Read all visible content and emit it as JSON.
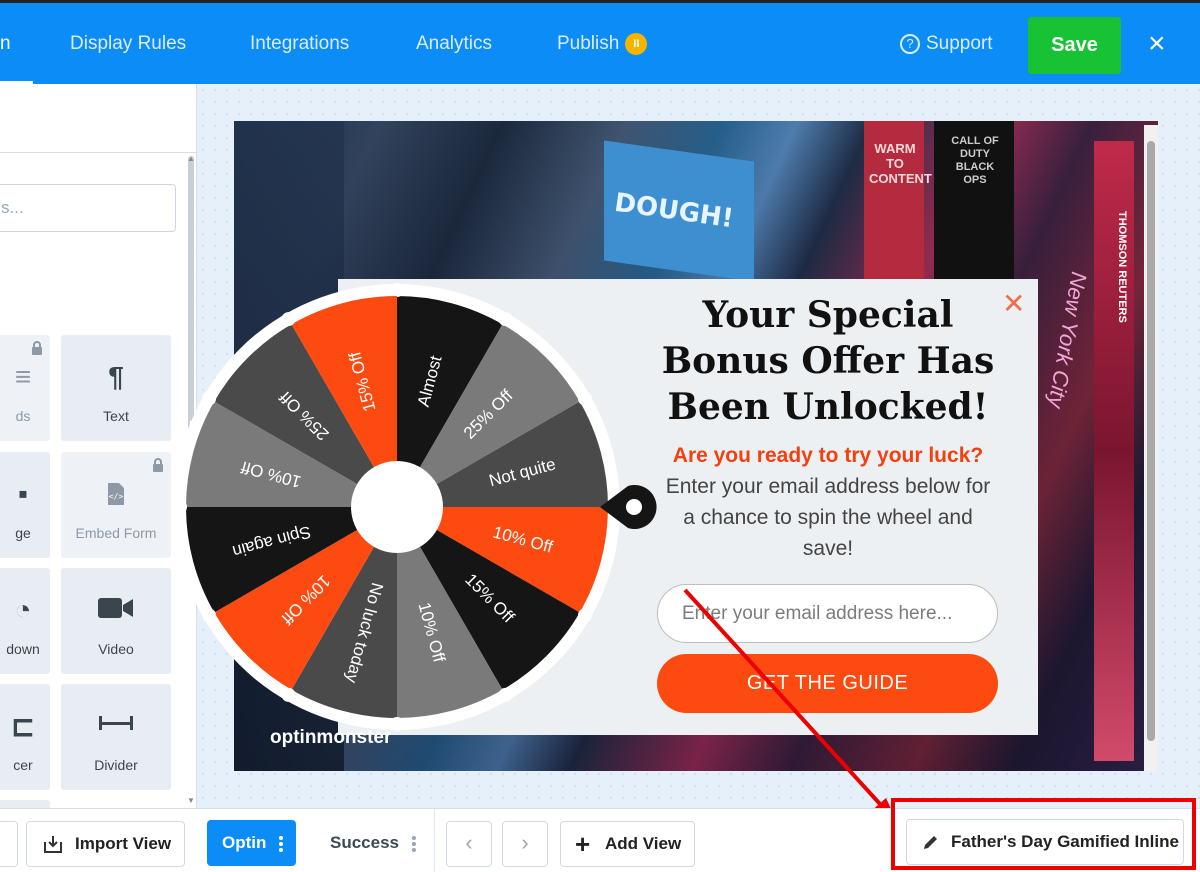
{
  "topnav": {
    "active_partial": "n",
    "items": [
      "Display Rules",
      "Integrations",
      "Analytics",
      "Publish"
    ],
    "publish_badge": "II",
    "support": "Support",
    "save": "Save",
    "close": "×"
  },
  "sidebar": {
    "search_placeholder": "s...",
    "tiles": [
      {
        "label": "ds",
        "icon": "list-icon",
        "locked": true
      },
      {
        "label": "Text",
        "icon": "paragraph-icon",
        "locked": false
      },
      {
        "label": "ge",
        "icon": "image-icon",
        "locked": false
      },
      {
        "label": "Embed Form",
        "icon": "embed-form-icon",
        "locked": true
      },
      {
        "label": "down",
        "icon": "countdown-icon",
        "locked": false
      },
      {
        "label": "Video",
        "icon": "video-icon",
        "locked": false
      },
      {
        "label": "cer",
        "icon": "spacer-icon",
        "locked": false
      },
      {
        "label": "Divider",
        "icon": "divider-icon",
        "locked": false
      }
    ]
  },
  "popup": {
    "headline": "Your Special Bonus Offer Has Been Unlocked!",
    "sub_highlight": "Are you ready to try your luck?",
    "sub_rest": " Enter your email address below for a chance to spin the wheel and save!",
    "email_placeholder": "Enter your email address here...",
    "cta": "GET THE GUIDE",
    "close": "✕",
    "brand": "optinmonster"
  },
  "wheel": {
    "segments": [
      "Almost",
      "25% Off",
      "Not quite",
      "10% Off",
      "15% Off",
      "10% Off",
      "No luck today",
      "10% Off",
      "Spin again",
      "10% Off",
      "25% Off",
      "15% Off"
    ],
    "colors": {
      "orange": "#fc4a10",
      "black": "#151515",
      "dark_gray": "#4a4a4a",
      "gray": "#7a7a7a"
    }
  },
  "city": {
    "sign_dough": "DOUGH!",
    "sign_warm": "WARM TO CONTENT",
    "sign_call": "CALL OF DUTY BLACK OPS",
    "sign_reuters": "THOMSON REUTERS",
    "sign_ny": "New York City"
  },
  "bottombar": {
    "import_view": "Import View",
    "optin": "Optin",
    "success": "Success",
    "prev": "‹",
    "next": "›",
    "add_view": "Add View",
    "campaign_name": "Father's Day Gamified Inline"
  },
  "colors": {
    "brand_blue": "#0b8cf6",
    "save_green": "#17c235",
    "cta_orange": "#fc4a10",
    "annotation_red": "#ec0000"
  }
}
